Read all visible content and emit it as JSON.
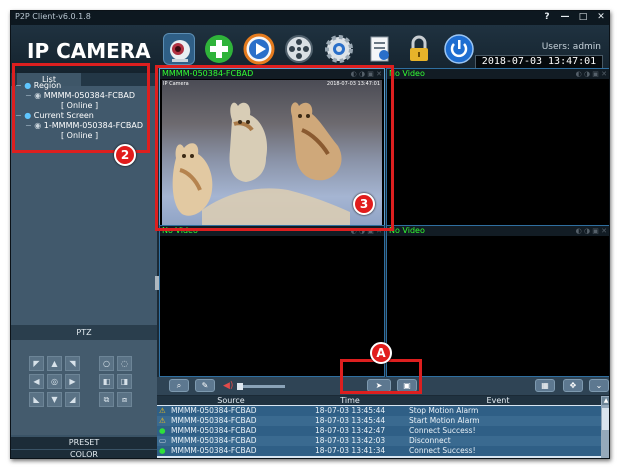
{
  "window": {
    "title": "P2P Client-v6.0.1.8",
    "help": "?",
    "minimize": "—",
    "maximize": "□",
    "close": "✕"
  },
  "app": {
    "logo": "IP CAMERA",
    "users": "Users: admin",
    "clock": "2018-07-03  13:47:01"
  },
  "toolbar_icons": [
    "camera-icon",
    "add-icon",
    "play-icon",
    "film-reel-icon",
    "settings-gear-icon",
    "document-icon",
    "lock-icon",
    "power-icon"
  ],
  "tree": {
    "tab": "List",
    "items": [
      {
        "label": "Region"
      },
      {
        "label": "MMMM-050384-FCBAD"
      },
      {
        "label": "[   Online   ]"
      },
      {
        "label": "Current Screen"
      },
      {
        "label": "1-MMMM-050384-FCBAD"
      },
      {
        "label": "[   Online   ]"
      }
    ]
  },
  "panels": {
    "ptz": "PTZ",
    "preset": "PRESET",
    "color": "COLOR"
  },
  "videos": [
    {
      "title": "MMMM-050384-FCBAD",
      "overlay_name": "IP Camera",
      "overlay_time": "2018-07-03 13:47:01"
    },
    {
      "title": "No Video"
    },
    {
      "title": "No Video"
    },
    {
      "title": "No Video"
    }
  ],
  "log": {
    "headers": {
      "source": "Source",
      "time": "Time",
      "event": "Event"
    },
    "rows": [
      {
        "icon": "warning-icon",
        "source": "MMMM-050384-FCBAD",
        "time": "18-07-03 13:45:44",
        "event": "Stop Motion Alarm"
      },
      {
        "icon": "warning-icon",
        "source": "MMMM-050384-FCBAD",
        "time": "18-07-03 13:45:44",
        "event": "Start Motion Alarm"
      },
      {
        "icon": "green-dot-icon",
        "source": "MMMM-050384-FCBAD",
        "time": "18-07-03 13:42:47",
        "event": "Connect Success!"
      },
      {
        "icon": "monitor-icon",
        "source": "MMMM-050384-FCBAD",
        "time": "18-07-03 13:42:03",
        "event": "Disconnect"
      },
      {
        "icon": "green-dot-icon",
        "source": "MMMM-050384-FCBAD",
        "time": "18-07-03 13:41:34",
        "event": "Connect Success!"
      }
    ]
  },
  "callouts": {
    "two": "2",
    "three": "3",
    "a": "A"
  },
  "colors": {
    "highlight": "#dd1f1f",
    "status_green": "#33ff33",
    "accent_blue": "#2f6fa0"
  }
}
